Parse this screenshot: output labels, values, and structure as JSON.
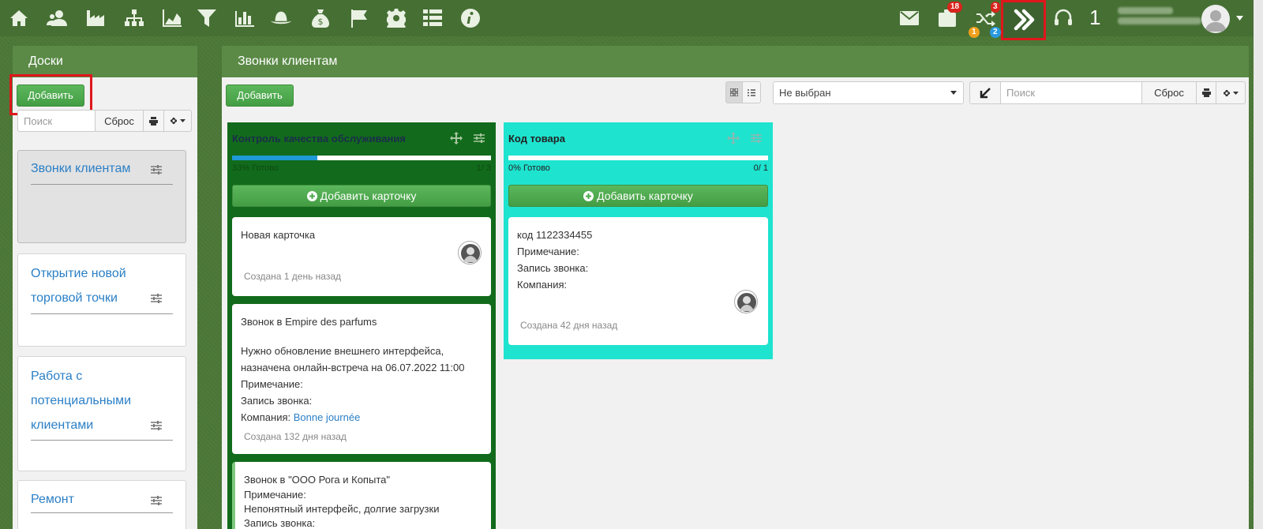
{
  "topbar": {
    "icons": [
      "home-icon",
      "users-icon",
      "factory-icon",
      "sitemap-icon",
      "area-chart-icon",
      "filter-icon",
      "bar-chart-icon",
      "hat-icon",
      "money-bag-icon",
      "flag-icon",
      "gear-icon",
      "list-icon",
      "info-icon"
    ],
    "mail_icon": "envelope-icon",
    "tasks_badge": "18",
    "shuffle_badge_top": "3",
    "shuffle_badge_orange": "1",
    "shuffle_badge_blue": "2",
    "counter": "1"
  },
  "sidebar": {
    "title": "Доски",
    "add_label": "Добавить",
    "search_placeholder": "Поиск",
    "reset_label": "Сброс",
    "boards": [
      {
        "label": "Звонки клиентам"
      },
      {
        "label": "Открытие новой торговой точки"
      },
      {
        "label": "Работа с потенциальными клиентами"
      },
      {
        "label": "Ремонт"
      }
    ]
  },
  "main": {
    "title": "Звонки клиентам",
    "add_label": "Добавить",
    "select_value": "Не выбран",
    "search_placeholder": "Поиск",
    "reset_label": "Сброс",
    "columns": [
      {
        "title": "Контроль качества обслуживания",
        "progress_text": "33% Готово",
        "progress_count": "1/ 3",
        "progress": 0.33,
        "color": "#126b1c",
        "add_card_label": "Добавить карточку",
        "cards": [
          {
            "title": "Новая карточка",
            "created": "Создана 1 день назад"
          },
          {
            "title": "Звонок в Empire des parfums",
            "body1": "Нужно обновление внешнего интерфейса,",
            "body2": "назначена онлайн-встреча на 06.07.2022 11:00",
            "note": "Примечание:",
            "record": "Запись звонка:",
            "company_label": "Компания:",
            "company_link": "Bonne journée",
            "created": "Создана 132 дня назад"
          },
          {
            "title": "Звонок в \"ООО Рога и Копыта\"",
            "note": "Примечание:",
            "body1": "Непонятный интерфейс, долгие загрузки",
            "record": "Запись звонка:"
          }
        ]
      },
      {
        "title": "Код товара",
        "progress_text": "0% Готово",
        "progress_count": "0/ 1",
        "progress": 0,
        "color": "#1ee3cf",
        "add_card_label": "Добавить карточку",
        "cards": [
          {
            "title": "код 1122334455",
            "note": "Примечание:",
            "record": "Запись звонка:",
            "company_label": "Компания:",
            "created": "Создана 42 дня назад"
          }
        ]
      }
    ]
  }
}
